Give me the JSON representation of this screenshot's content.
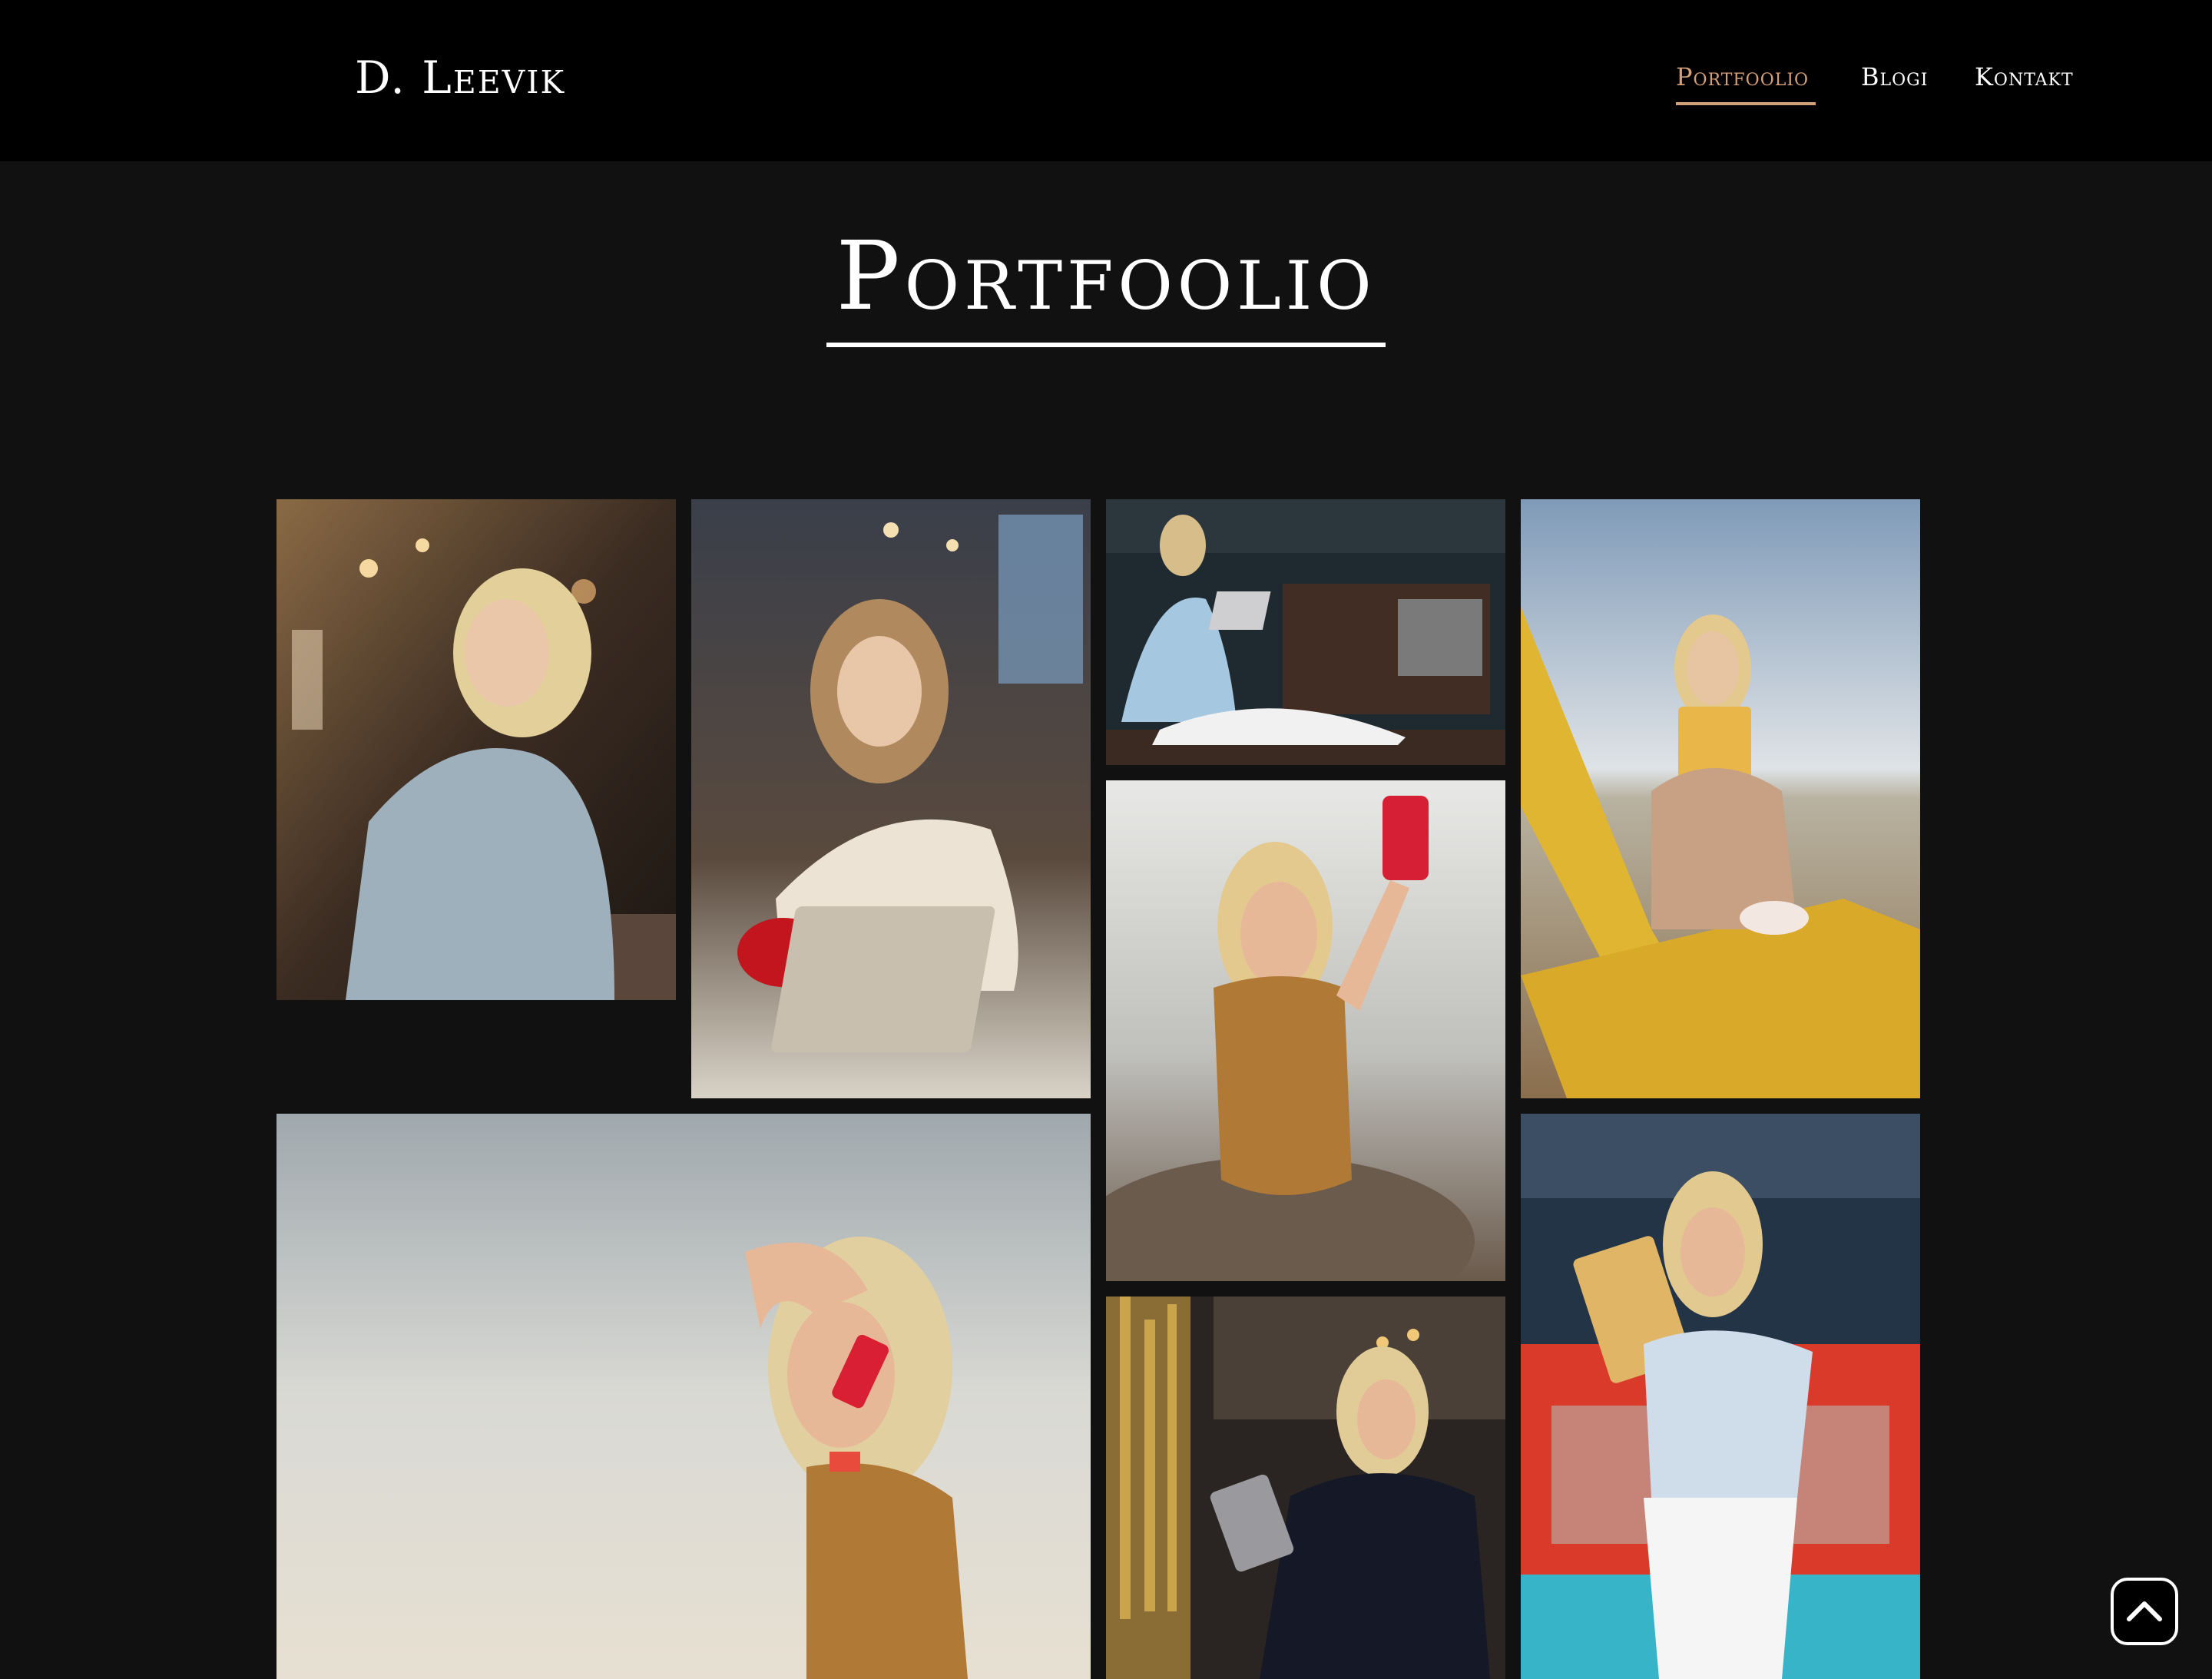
{
  "header": {
    "logo": "D. Leevik",
    "nav": [
      {
        "label": "Portfoolio",
        "active": true
      },
      {
        "label": "Blogi",
        "active": false
      },
      {
        "label": "Kontakt",
        "active": false
      }
    ]
  },
  "main": {
    "title": "Portfoolio"
  },
  "colors": {
    "header_bg": "#000000",
    "page_bg": "#111111",
    "accent": "#d4a07a",
    "text": "#ffffff"
  },
  "gallery": {
    "photos": [
      {
        "name": "photo-woman-phone-cafe"
      },
      {
        "name": "photo-woman-coffee-laptop"
      },
      {
        "name": "photo-woman-laptop-pier"
      },
      {
        "name": "photo-woman-tablet-beach-bench"
      },
      {
        "name": "photo-woman-selfie-beach"
      },
      {
        "name": "photo-woman-phone-sky"
      },
      {
        "name": "photo-woman-tablet-lounge"
      },
      {
        "name": "photo-woman-tablet-truck"
      }
    ]
  },
  "scroll_top": {
    "icon": "chevron-up-icon"
  }
}
